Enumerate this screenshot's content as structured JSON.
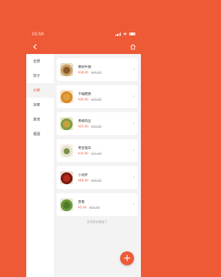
{
  "statusbar": {
    "time": "15:50"
  },
  "categories": [
    {
      "label": "全部"
    },
    {
      "label": "饺子"
    },
    {
      "label": "炒菜"
    },
    {
      "label": "凉菜"
    },
    {
      "label": "其他"
    },
    {
      "label": "烟酒"
    }
  ],
  "active_category": "炒菜",
  "dishes": [
    {
      "name": "黄焖牛腩",
      "price": "¥38.00",
      "original_price": "¥46.00"
    },
    {
      "name": "干煸肥肠",
      "price": "¥30.00",
      "original_price": "¥35.00"
    },
    {
      "name": "青椒肉丝",
      "price": "¥25.00",
      "original_price": "¥20.00"
    },
    {
      "name": "青豆笼白",
      "price": "¥16.00",
      "original_price": "¥21.00"
    },
    {
      "name": "小龙虾",
      "price": "¥68.00",
      "original_price": "¥76.00"
    },
    {
      "name": "苦菊",
      "price": "¥5.00",
      "original_price": "¥10.00"
    }
  ],
  "footer_tip": "没有更多数据了",
  "colors": {
    "accent": "#ee5a36",
    "background": "#f3f3f3"
  },
  "icons": {
    "back": "back-arrow-icon",
    "home": "home-icon",
    "add": "plus-icon",
    "row": "chevron-right-icon"
  }
}
